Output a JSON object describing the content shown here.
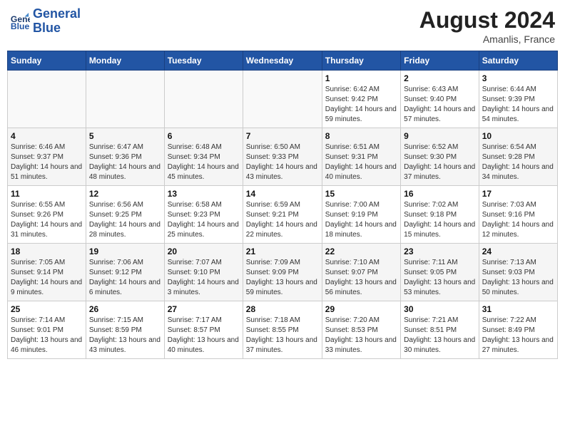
{
  "header": {
    "logo_line1": "General",
    "logo_line2": "Blue",
    "month_year": "August 2024",
    "location": "Amanlis, France"
  },
  "days_of_week": [
    "Sunday",
    "Monday",
    "Tuesday",
    "Wednesday",
    "Thursday",
    "Friday",
    "Saturday"
  ],
  "weeks": [
    [
      {
        "day": "",
        "sunrise": "",
        "sunset": "",
        "daylight": ""
      },
      {
        "day": "",
        "sunrise": "",
        "sunset": "",
        "daylight": ""
      },
      {
        "day": "",
        "sunrise": "",
        "sunset": "",
        "daylight": ""
      },
      {
        "day": "",
        "sunrise": "",
        "sunset": "",
        "daylight": ""
      },
      {
        "day": "1",
        "sunrise": "Sunrise: 6:42 AM",
        "sunset": "Sunset: 9:42 PM",
        "daylight": "Daylight: 14 hours and 59 minutes."
      },
      {
        "day": "2",
        "sunrise": "Sunrise: 6:43 AM",
        "sunset": "Sunset: 9:40 PM",
        "daylight": "Daylight: 14 hours and 57 minutes."
      },
      {
        "day": "3",
        "sunrise": "Sunrise: 6:44 AM",
        "sunset": "Sunset: 9:39 PM",
        "daylight": "Daylight: 14 hours and 54 minutes."
      }
    ],
    [
      {
        "day": "4",
        "sunrise": "Sunrise: 6:46 AM",
        "sunset": "Sunset: 9:37 PM",
        "daylight": "Daylight: 14 hours and 51 minutes."
      },
      {
        "day": "5",
        "sunrise": "Sunrise: 6:47 AM",
        "sunset": "Sunset: 9:36 PM",
        "daylight": "Daylight: 14 hours and 48 minutes."
      },
      {
        "day": "6",
        "sunrise": "Sunrise: 6:48 AM",
        "sunset": "Sunset: 9:34 PM",
        "daylight": "Daylight: 14 hours and 45 minutes."
      },
      {
        "day": "7",
        "sunrise": "Sunrise: 6:50 AM",
        "sunset": "Sunset: 9:33 PM",
        "daylight": "Daylight: 14 hours and 43 minutes."
      },
      {
        "day": "8",
        "sunrise": "Sunrise: 6:51 AM",
        "sunset": "Sunset: 9:31 PM",
        "daylight": "Daylight: 14 hours and 40 minutes."
      },
      {
        "day": "9",
        "sunrise": "Sunrise: 6:52 AM",
        "sunset": "Sunset: 9:30 PM",
        "daylight": "Daylight: 14 hours and 37 minutes."
      },
      {
        "day": "10",
        "sunrise": "Sunrise: 6:54 AM",
        "sunset": "Sunset: 9:28 PM",
        "daylight": "Daylight: 14 hours and 34 minutes."
      }
    ],
    [
      {
        "day": "11",
        "sunrise": "Sunrise: 6:55 AM",
        "sunset": "Sunset: 9:26 PM",
        "daylight": "Daylight: 14 hours and 31 minutes."
      },
      {
        "day": "12",
        "sunrise": "Sunrise: 6:56 AM",
        "sunset": "Sunset: 9:25 PM",
        "daylight": "Daylight: 14 hours and 28 minutes."
      },
      {
        "day": "13",
        "sunrise": "Sunrise: 6:58 AM",
        "sunset": "Sunset: 9:23 PM",
        "daylight": "Daylight: 14 hours and 25 minutes."
      },
      {
        "day": "14",
        "sunrise": "Sunrise: 6:59 AM",
        "sunset": "Sunset: 9:21 PM",
        "daylight": "Daylight: 14 hours and 22 minutes."
      },
      {
        "day": "15",
        "sunrise": "Sunrise: 7:00 AM",
        "sunset": "Sunset: 9:19 PM",
        "daylight": "Daylight: 14 hours and 18 minutes."
      },
      {
        "day": "16",
        "sunrise": "Sunrise: 7:02 AM",
        "sunset": "Sunset: 9:18 PM",
        "daylight": "Daylight: 14 hours and 15 minutes."
      },
      {
        "day": "17",
        "sunrise": "Sunrise: 7:03 AM",
        "sunset": "Sunset: 9:16 PM",
        "daylight": "Daylight: 14 hours and 12 minutes."
      }
    ],
    [
      {
        "day": "18",
        "sunrise": "Sunrise: 7:05 AM",
        "sunset": "Sunset: 9:14 PM",
        "daylight": "Daylight: 14 hours and 9 minutes."
      },
      {
        "day": "19",
        "sunrise": "Sunrise: 7:06 AM",
        "sunset": "Sunset: 9:12 PM",
        "daylight": "Daylight: 14 hours and 6 minutes."
      },
      {
        "day": "20",
        "sunrise": "Sunrise: 7:07 AM",
        "sunset": "Sunset: 9:10 PM",
        "daylight": "Daylight: 14 hours and 3 minutes."
      },
      {
        "day": "21",
        "sunrise": "Sunrise: 7:09 AM",
        "sunset": "Sunset: 9:09 PM",
        "daylight": "Daylight: 13 hours and 59 minutes."
      },
      {
        "day": "22",
        "sunrise": "Sunrise: 7:10 AM",
        "sunset": "Sunset: 9:07 PM",
        "daylight": "Daylight: 13 hours and 56 minutes."
      },
      {
        "day": "23",
        "sunrise": "Sunrise: 7:11 AM",
        "sunset": "Sunset: 9:05 PM",
        "daylight": "Daylight: 13 hours and 53 minutes."
      },
      {
        "day": "24",
        "sunrise": "Sunrise: 7:13 AM",
        "sunset": "Sunset: 9:03 PM",
        "daylight": "Daylight: 13 hours and 50 minutes."
      }
    ],
    [
      {
        "day": "25",
        "sunrise": "Sunrise: 7:14 AM",
        "sunset": "Sunset: 9:01 PM",
        "daylight": "Daylight: 13 hours and 46 minutes."
      },
      {
        "day": "26",
        "sunrise": "Sunrise: 7:15 AM",
        "sunset": "Sunset: 8:59 PM",
        "daylight": "Daylight: 13 hours and 43 minutes."
      },
      {
        "day": "27",
        "sunrise": "Sunrise: 7:17 AM",
        "sunset": "Sunset: 8:57 PM",
        "daylight": "Daylight: 13 hours and 40 minutes."
      },
      {
        "day": "28",
        "sunrise": "Sunrise: 7:18 AM",
        "sunset": "Sunset: 8:55 PM",
        "daylight": "Daylight: 13 hours and 37 minutes."
      },
      {
        "day": "29",
        "sunrise": "Sunrise: 7:20 AM",
        "sunset": "Sunset: 8:53 PM",
        "daylight": "Daylight: 13 hours and 33 minutes."
      },
      {
        "day": "30",
        "sunrise": "Sunrise: 7:21 AM",
        "sunset": "Sunset: 8:51 PM",
        "daylight": "Daylight: 13 hours and 30 minutes."
      },
      {
        "day": "31",
        "sunrise": "Sunrise: 7:22 AM",
        "sunset": "Sunset: 8:49 PM",
        "daylight": "Daylight: 13 hours and 27 minutes."
      }
    ]
  ]
}
